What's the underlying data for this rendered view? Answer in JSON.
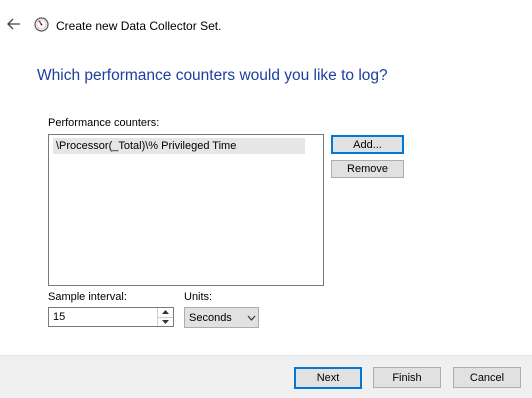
{
  "window": {
    "title": "Create new Data Collector Set."
  },
  "page": {
    "heading": "Which performance counters would you like to log?"
  },
  "counters": {
    "label": "Performance counters:",
    "items": [
      "\\Processor(_Total)\\% Privileged Time"
    ],
    "add_label": "Add...",
    "remove_label": "Remove"
  },
  "sample": {
    "interval_label": "Sample interval:",
    "interval_value": "15",
    "units_label": "Units:",
    "units_value": "Seconds"
  },
  "footer": {
    "next_label": "Next",
    "finish_label": "Finish",
    "cancel_label": "Cancel"
  },
  "icons": {
    "back": "arrow-left-icon",
    "app": "performance-gauge-icon",
    "spin_up": "triangle-up-icon",
    "spin_down": "triangle-down-icon",
    "dropdown": "chevron-down-icon"
  },
  "colors": {
    "heading": "#1b3fa0",
    "default_button_border": "#0078d7",
    "button_bg": "#e1e1e1",
    "footer_bg": "#f0f0f0",
    "selected_item_bg": "#e6e6e6"
  }
}
